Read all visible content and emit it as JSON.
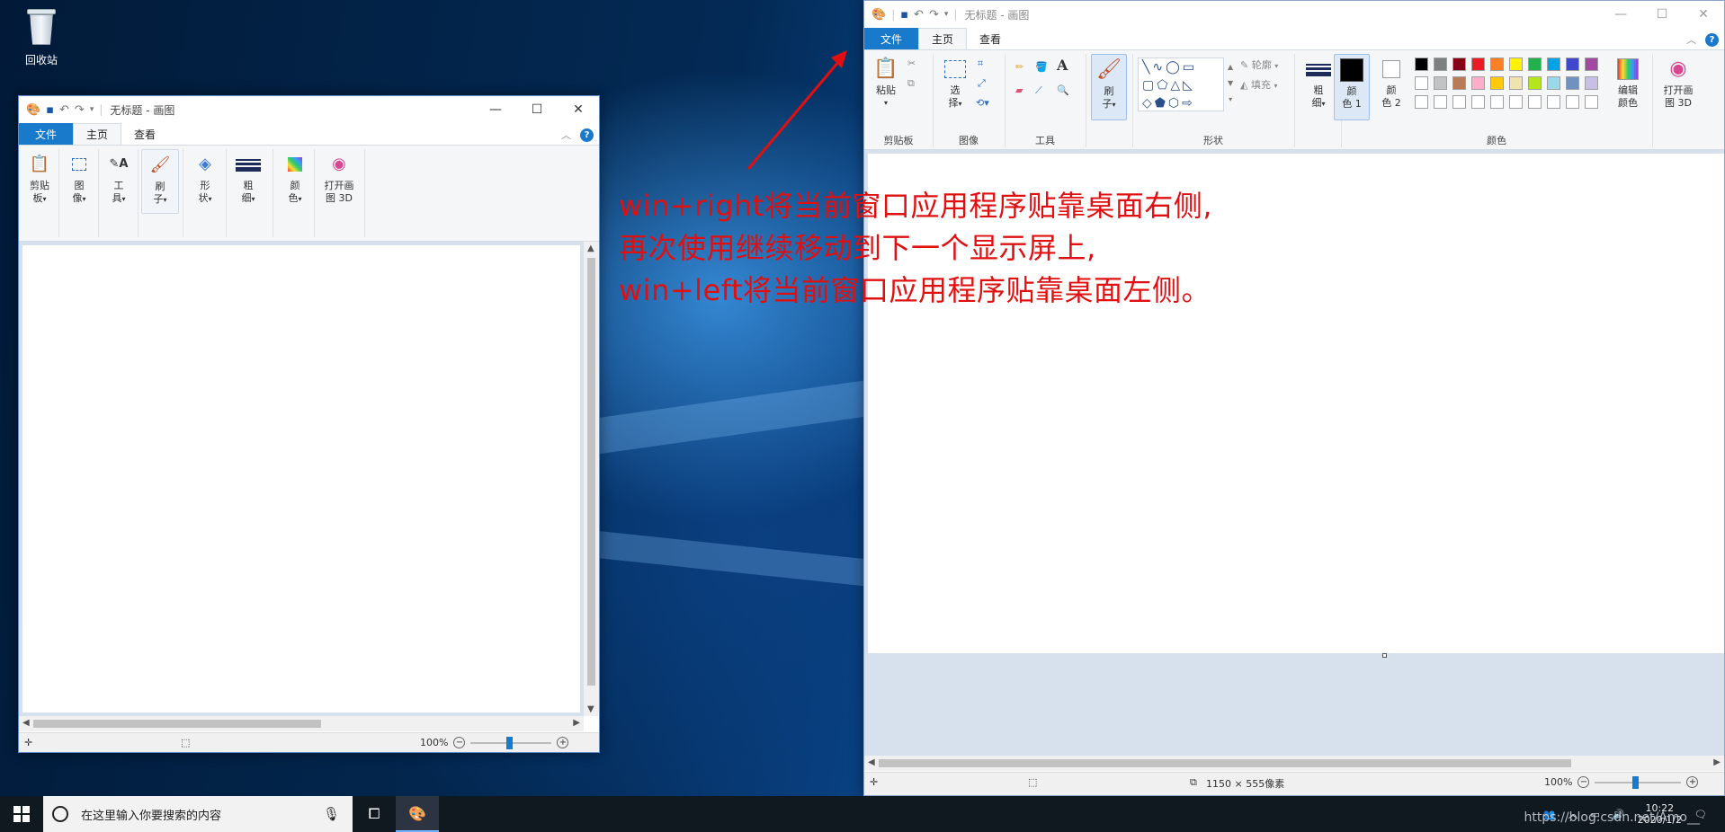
{
  "desktop": {
    "recycle_bin_label": "回收站"
  },
  "left_window": {
    "title": "无标题 - 画图",
    "tabs": [
      "文件",
      "主页",
      "查看"
    ],
    "ribbon": [
      {
        "label1": "剪贴",
        "label2": "板"
      },
      {
        "label1": "图",
        "label2": "像"
      },
      {
        "label1": "工",
        "label2": "具"
      },
      {
        "label1": "刷",
        "label2": "子"
      },
      {
        "label1": "形",
        "label2": "状"
      },
      {
        "label1": "粗",
        "label2": "细"
      },
      {
        "label1": "颜",
        "label2": "色"
      },
      {
        "label1": "打开画",
        "label2": "图 3D"
      }
    ],
    "zoom": "100%"
  },
  "right_window": {
    "title": "无标题 - 画图",
    "tabs": [
      "文件",
      "主页",
      "查看"
    ],
    "paste_label": "粘贴",
    "select_label1": "选",
    "select_label2": "择",
    "brush_label1": "刷",
    "brush_label2": "子",
    "outline_label": "轮廓",
    "fill_label": "填充",
    "size_label1": "粗",
    "size_label2": "细",
    "color1_label1": "颜",
    "color1_label2": "色 1",
    "color2_label1": "颜",
    "color2_label2": "色 2",
    "edit_colors_label1": "编辑",
    "edit_colors_label2": "颜色",
    "paint3d_label1": "打开画",
    "paint3d_label2": "图 3D",
    "groups": [
      "剪贴板",
      "图像",
      "工具",
      "形状",
      "颜色"
    ],
    "canvas_size": "1150 × 555像素",
    "zoom": "100%",
    "palette_row1": [
      "#000000",
      "#7f7f7f",
      "#880015",
      "#ed1c24",
      "#ff7f27",
      "#fff200",
      "#22b14c",
      "#00a2e8",
      "#3f48cc",
      "#a349a4"
    ],
    "palette_row2": [
      "#ffffff",
      "#c3c3c3",
      "#b97a57",
      "#ffaec9",
      "#ffc90e",
      "#efe4b0",
      "#b5e61d",
      "#99d9ea",
      "#7092be",
      "#c8bfe7"
    ]
  },
  "annotation": {
    "line1": "win+right将当前窗口应用程序贴靠桌面右侧,",
    "line2": "再次使用继续移动到下一个显示屏上,",
    "line3": "win+left将当前窗口应用程序贴靠桌面左侧。"
  },
  "taskbar": {
    "search_placeholder": "在这里输入你要搜索的内容",
    "time": "10:22",
    "date": "2020/1/2"
  },
  "watermark": "https://blog.csdn.net/Amo__"
}
